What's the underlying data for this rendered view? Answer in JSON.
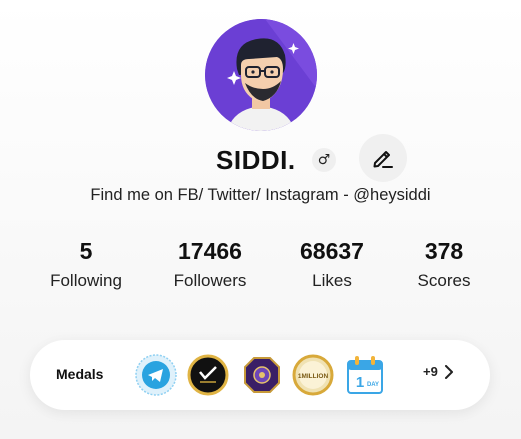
{
  "profile": {
    "username": "SIDDI.",
    "gender_symbol": "♂",
    "bio": "Find me on FB/ Twitter/ Instagram - @heysiddi"
  },
  "stats": [
    {
      "value": "5",
      "label": "Following"
    },
    {
      "value": "17466",
      "label": "Followers"
    },
    {
      "value": "68637",
      "label": "Likes"
    },
    {
      "value": "378",
      "label": "Scores"
    }
  ],
  "medals": {
    "label": "Medals",
    "badge_one_million": "1MILLION",
    "badge_day": "1",
    "badge_day_sub": "DAY",
    "more_count": "+9"
  },
  "colors": {
    "accent": "#6b3fd4",
    "telegram": "#2aa3e0",
    "gold": "#d8a93a"
  },
  "icons": [
    "gender-male-icon",
    "pencil-edit-icon",
    "telegram-icon",
    "chevron-right-icon"
  ]
}
